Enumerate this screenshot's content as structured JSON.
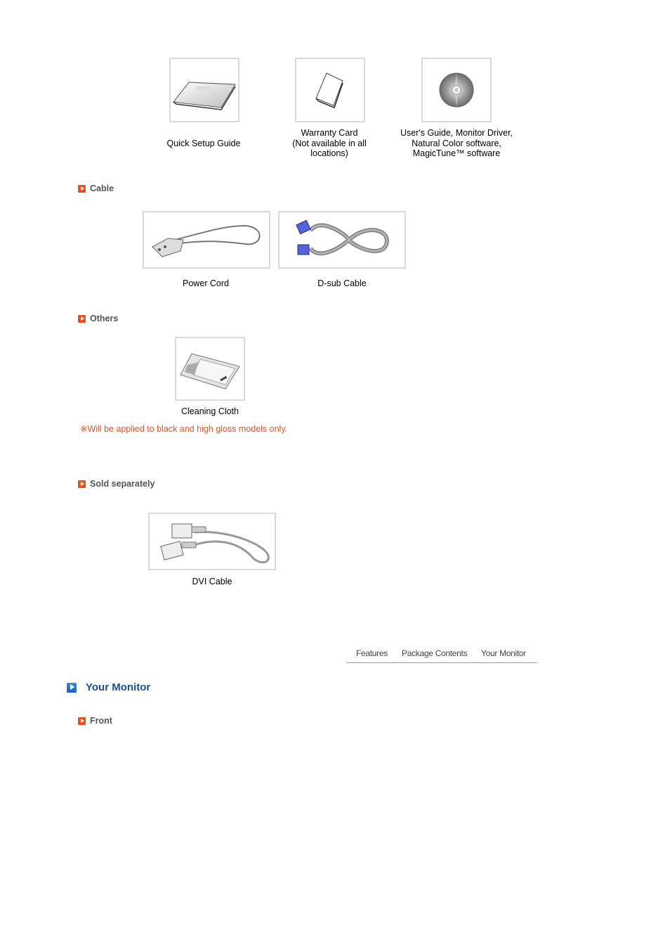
{
  "package_items": [
    {
      "label": "Quick Setup Guide",
      "icon": "setup-guide-image"
    },
    {
      "label": "Warranty Card\n(Not available in all\nlocations)",
      "line1": "Warranty Card",
      "line2": "(Not available in all",
      "line3": "locations)",
      "icon": "warranty-card-image"
    },
    {
      "line1": "User's Guide, Monitor Driver,",
      "line2": "Natural Color software,",
      "line3": "MagicTune™ software",
      "icon": "cd-image"
    }
  ],
  "sections": {
    "cable": {
      "title": "Cable",
      "items": [
        {
          "label": "Power Cord",
          "icon": "power-cord-image"
        },
        {
          "label": "D-sub Cable",
          "icon": "dsub-cable-image"
        }
      ]
    },
    "others": {
      "title": "Others",
      "items": [
        {
          "label": "Cleaning Cloth",
          "icon": "cleaning-cloth-image"
        }
      ],
      "note": "※Will be applied to black and high gloss models only."
    },
    "sold_separately": {
      "title": "Sold separately",
      "items": [
        {
          "label": "DVI Cable",
          "icon": "dvi-cable-image"
        }
      ]
    },
    "front": {
      "title": "Front"
    }
  },
  "nav": {
    "links": [
      "Features",
      "Package Contents",
      "Your Monitor"
    ]
  },
  "your_monitor": {
    "title": "Your Monitor"
  },
  "colors": {
    "section_icon": "#e2531f",
    "section_text": "#555555",
    "note_text": "#e2531f",
    "heading_blue": "#1a4f94",
    "box_border": "#d9d9d9"
  }
}
